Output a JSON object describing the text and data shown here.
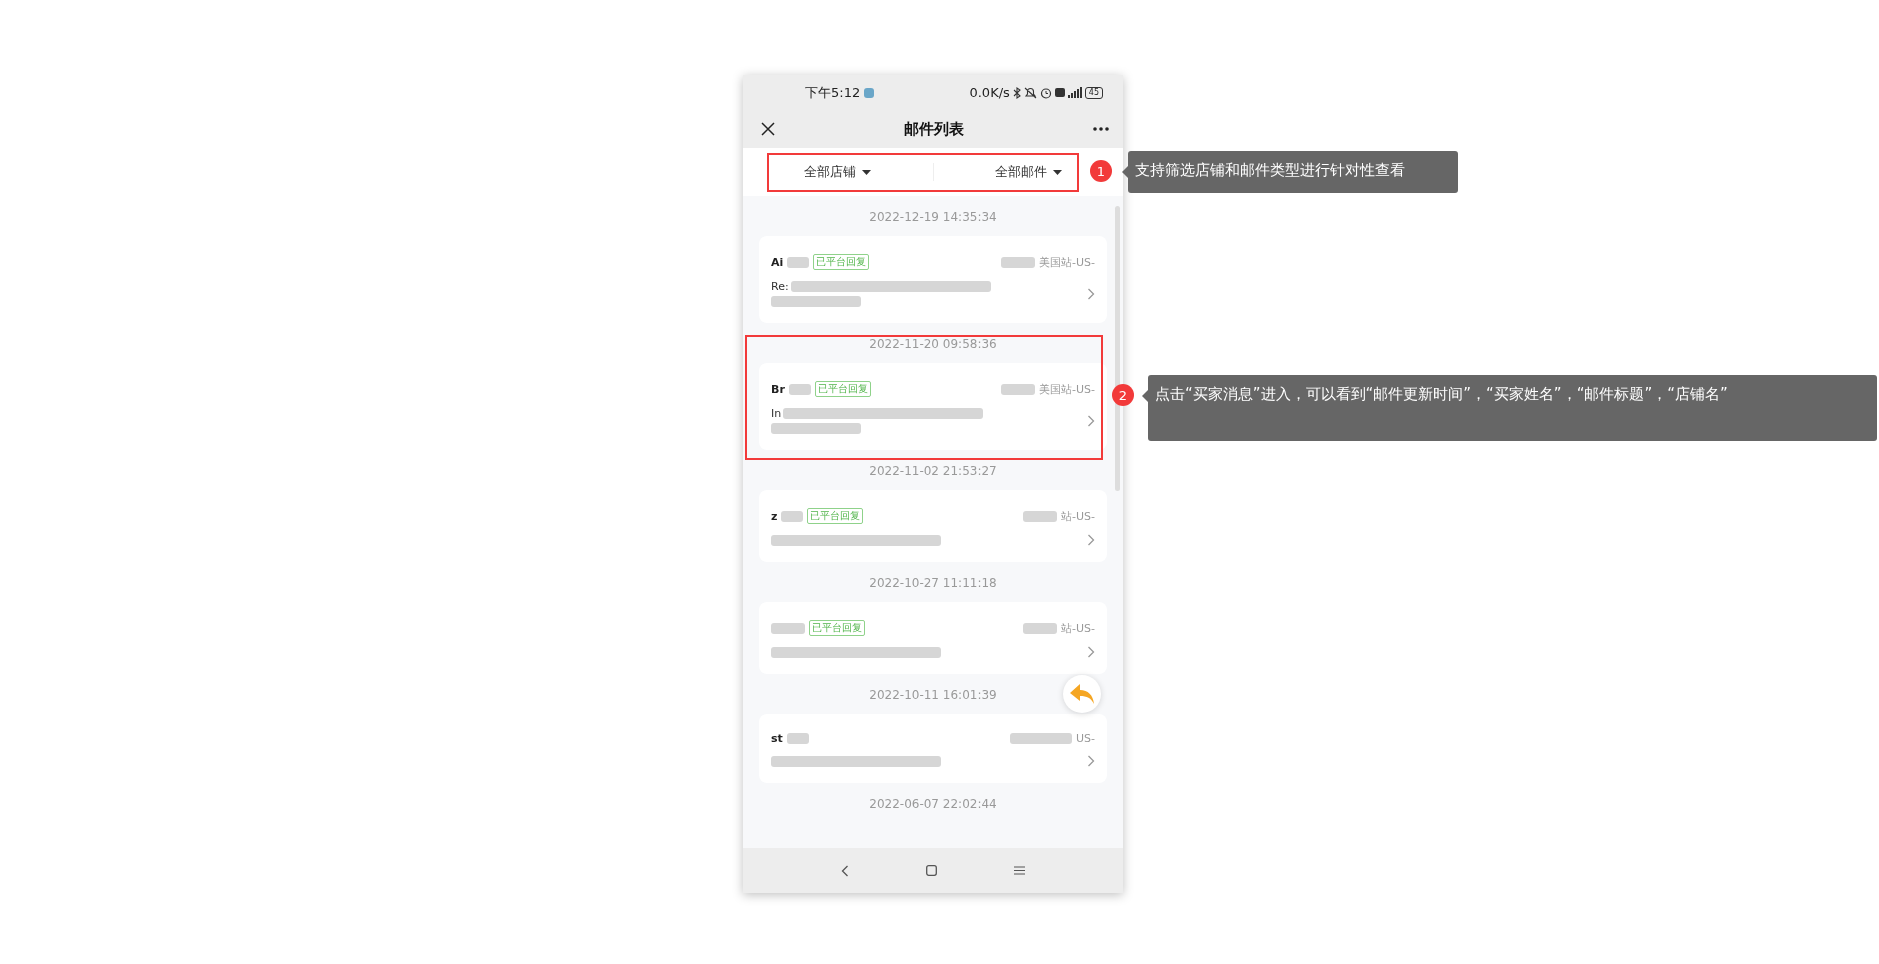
{
  "status_bar": {
    "time": "下午5:12",
    "speed": "0.0K/s",
    "battery": "45"
  },
  "title": "邮件列表",
  "filters": [
    {
      "label": "全部店铺"
    },
    {
      "label": "全部邮件"
    }
  ],
  "emails": [
    {
      "date": "2022-12-19 14:35:34",
      "name": "Ai",
      "replied": true,
      "tag": "已平台回复",
      "shop": "美国站-US-",
      "subject": "Re:",
      "two_line_subject": true
    },
    {
      "date": "2022-11-20 09:58:36",
      "name": "Br",
      "replied": true,
      "tag": "已平台回复",
      "shop": "美国站-US-",
      "subject": "In",
      "two_line_subject": true
    },
    {
      "date": "2022-11-02 21:53:27",
      "name": "z",
      "replied": true,
      "tag": "已平台回复",
      "shop": "站-US-",
      "two_line_subject": false
    },
    {
      "date": "2022-10-27 11:11:18",
      "replied": true,
      "tag": "已平台回复",
      "shop": "站-US-",
      "two_line_subject": false
    },
    {
      "date": "2022-10-11 16:01:39",
      "name": "st",
      "replied": false,
      "shop": "US-",
      "two_line_subject": false
    }
  ],
  "next_date": "2022-06-07 22:02:44",
  "annotations": [
    {
      "number": "1",
      "text": "支持筛选店铺和邮件类型进行针对性查看"
    },
    {
      "number": "2",
      "text": "点击“买家消息”进入，可以看到“邮件更新时间”，“买家姓名”，“邮件标题”，“店铺名”"
    }
  ]
}
